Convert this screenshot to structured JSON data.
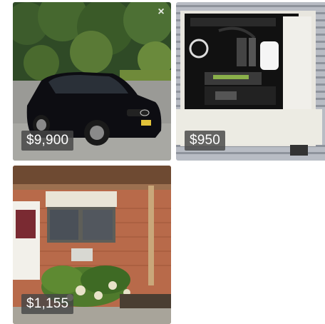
{
  "listings": [
    {
      "price": "$9,900",
      "image_subject": "black sedan parked in driveway",
      "dismiss_icon": "close-icon"
    },
    {
      "price": "$950",
      "image_subject": "desktop PC open case with graphics card"
    },
    {
      "price": "$1,155",
      "image_subject": "brick building with window and hydrangea bush"
    }
  ],
  "colors": {
    "price_badge_bg": "#464646",
    "price_text": "#ffffff",
    "page_bg": "#ffffff"
  }
}
